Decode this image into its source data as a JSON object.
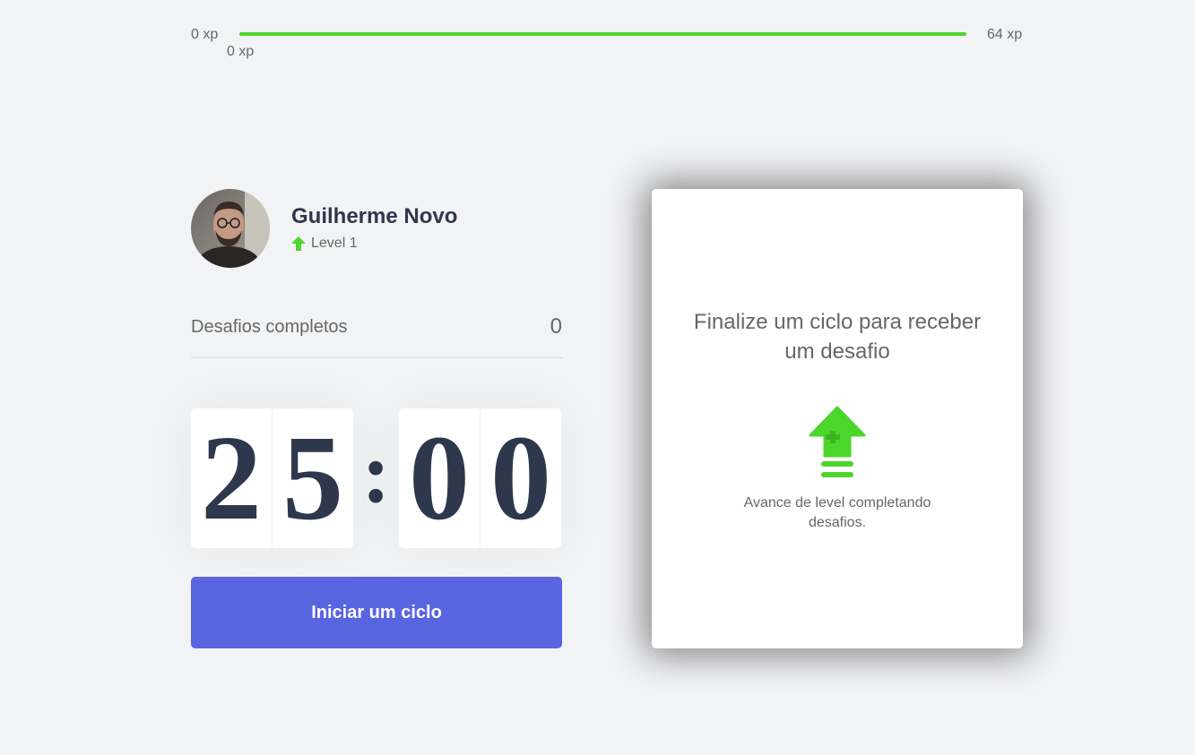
{
  "xp_bar": {
    "min_label": "0 xp",
    "current_label": "0 xp",
    "max_label": "64 xp",
    "progress_fraction": 1.0,
    "fill_color": "#4cd62b"
  },
  "profile": {
    "avatar_icon": "user-avatar-photo",
    "name": "Guilherme Novo",
    "level_icon": "arrow-up-icon",
    "level_label": "Level 1"
  },
  "completed_challenges": {
    "label": "Desafios completos",
    "count": "0"
  },
  "countdown": {
    "minute_left": "2",
    "minute_right": "5",
    "separator": ":",
    "second_left": "0",
    "second_right": "0"
  },
  "start_button": {
    "label": "Iniciar um ciclo",
    "color": "#5965e0"
  },
  "challenge_box": {
    "title": "Finalize um ciclo para receber um desafio",
    "icon": "level-up-icon",
    "hint": "Avance de level completando desafios."
  }
}
